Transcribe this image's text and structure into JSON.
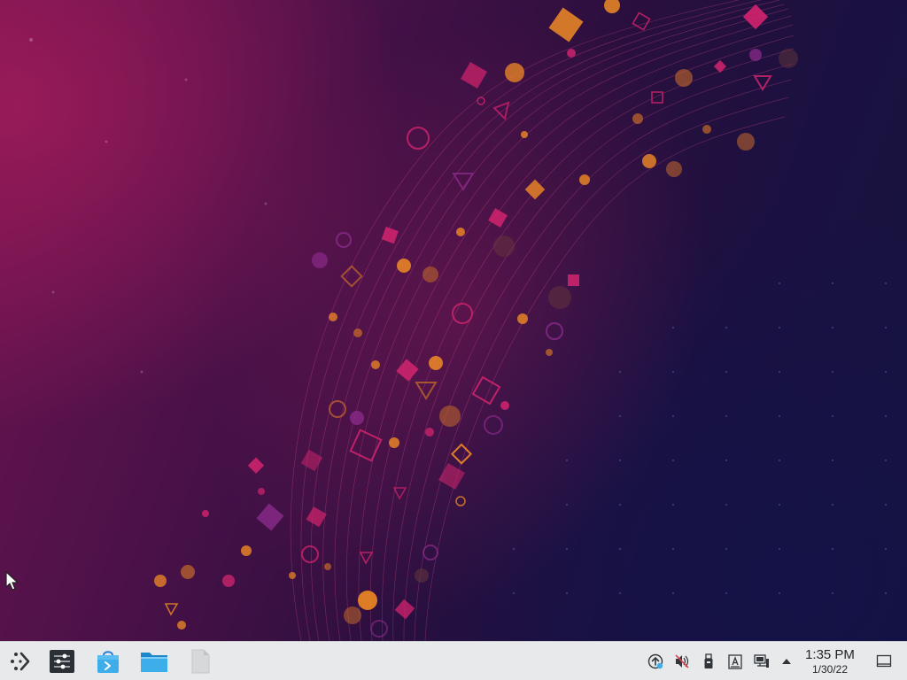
{
  "desktop": {
    "wallpaper": "kde-plasma-abstract-wave",
    "colors": {
      "magenta": "#d4246e",
      "orange": "#f08a24",
      "purple": "#8a2a8a",
      "deep_navy": "#15133e"
    }
  },
  "taskbar": {
    "launchers": [
      {
        "name": "application-launcher",
        "icon": "kde-launcher-icon"
      },
      {
        "name": "system-settings",
        "icon": "settings-sliders-icon"
      },
      {
        "name": "discover",
        "icon": "software-store-bag-icon"
      },
      {
        "name": "file-manager",
        "icon": "folder-icon"
      },
      {
        "name": "document",
        "icon": "blank-document-icon"
      }
    ],
    "tray": [
      {
        "name": "updates",
        "icon": "update-arrow-icon"
      },
      {
        "name": "volume",
        "icon": "speaker-muted-icon"
      },
      {
        "name": "removable-devices",
        "icon": "usb-drive-icon"
      },
      {
        "name": "clipboard",
        "icon": "clipboard-icon"
      },
      {
        "name": "network",
        "icon": "wired-network-icon"
      },
      {
        "name": "show-hidden",
        "icon": "chevron-up-icon"
      }
    ],
    "clock": {
      "time": "1:35 PM",
      "date": "1/30/22"
    },
    "show_desktop_icon": "show-desktop-icon"
  }
}
